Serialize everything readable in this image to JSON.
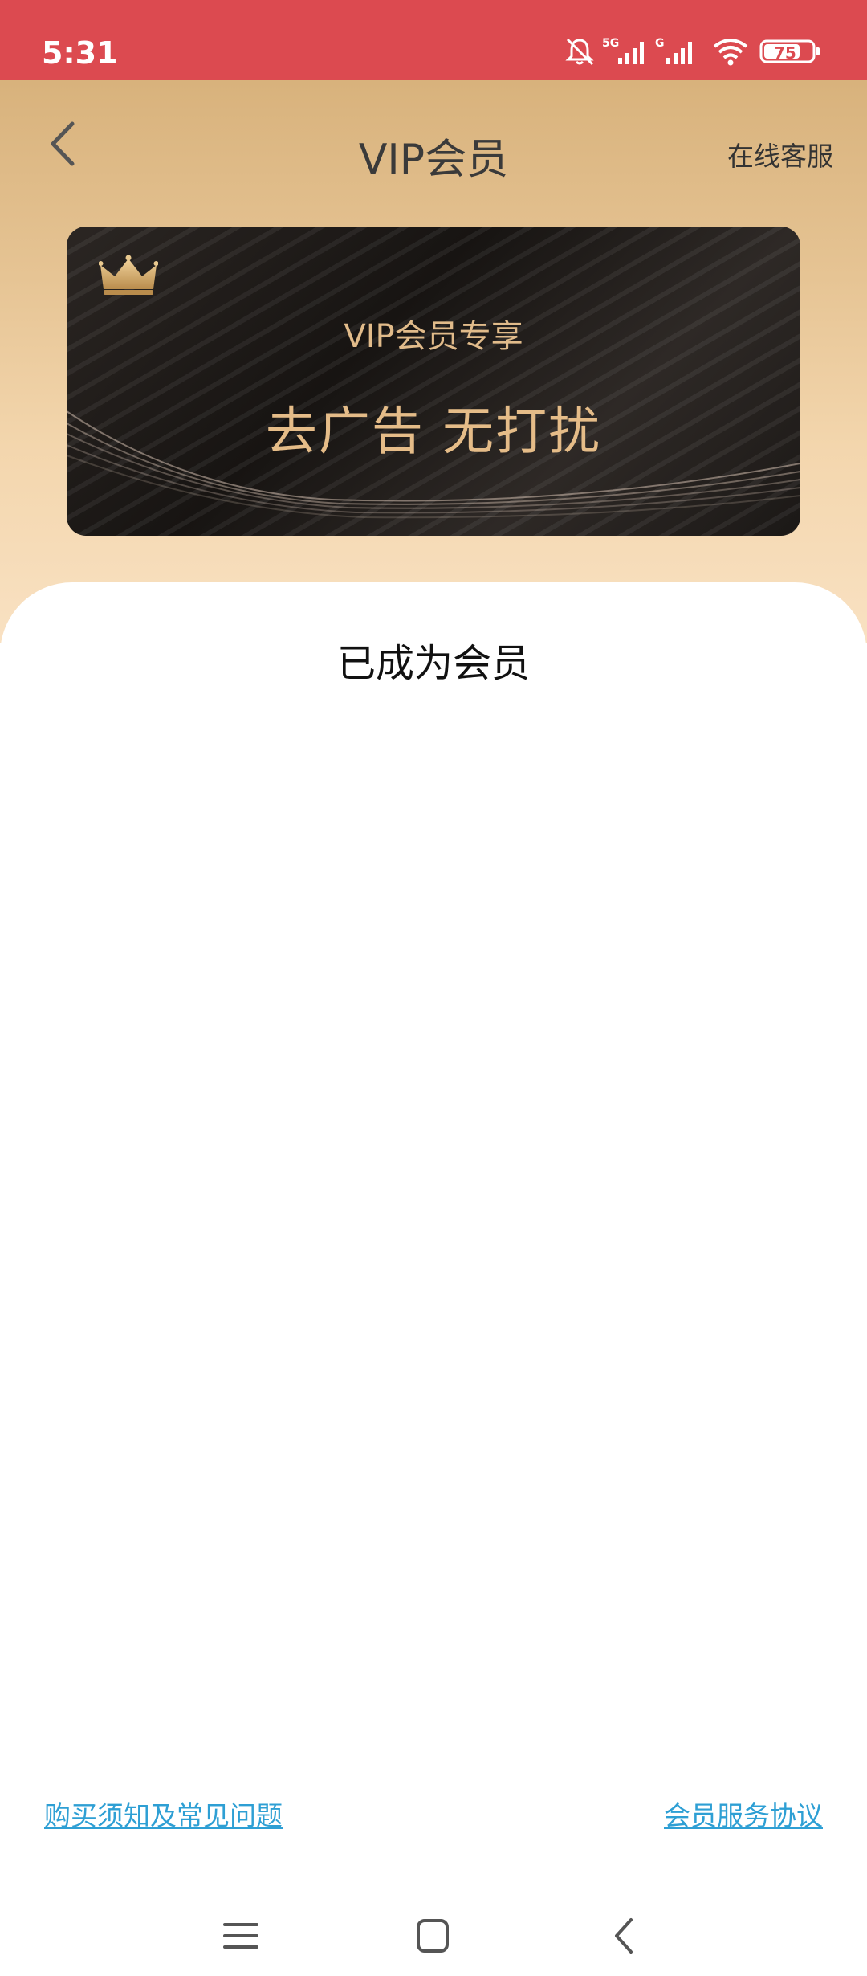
{
  "status_bar": {
    "time": "5:31",
    "battery": "75",
    "icons": [
      "bell-muted-icon",
      "signal-5g-icon",
      "signal-g-icon",
      "wifi-icon",
      "battery-icon"
    ],
    "network_labels": [
      "5G",
      "G"
    ],
    "background": "#dc4a50"
  },
  "header": {
    "title": "VIP会员",
    "service_label": "在线客服",
    "back_icon": "chevron-left-icon"
  },
  "banner": {
    "subtitle": "VIP会员专享",
    "headline": "去广告 无打扰",
    "icon": "crown-icon"
  },
  "content": {
    "status_text": "已成为会员"
  },
  "footer": {
    "faq_link": "购买须知及常见问题",
    "agreement_link": "会员服务协议",
    "link_color": "#2e9fd4"
  },
  "nav": {
    "menu_icon": "menu-icon",
    "home_icon": "home-square-icon",
    "back_icon": "back-triangle-icon"
  },
  "colors": {
    "header_gradient_top": "#d8b27c",
    "header_gradient_bottom": "#f9e1c2",
    "gold_text": "#e5bc88"
  }
}
